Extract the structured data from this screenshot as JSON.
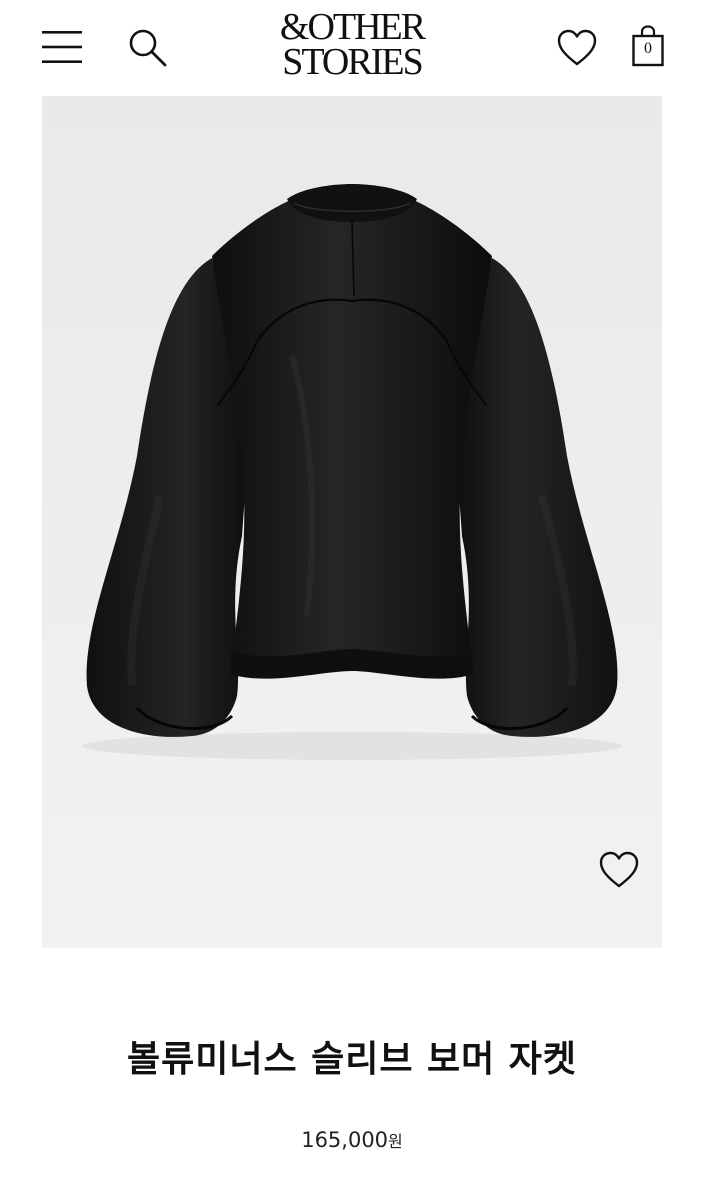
{
  "header": {
    "logo_line1": "&OTHER",
    "logo_line2": "STORIES",
    "cart_count": "0",
    "icons": [
      "menu-icon",
      "search-icon",
      "heart-icon",
      "shopping-bag-icon"
    ]
  },
  "product": {
    "image_icon": "heart-icon",
    "name": "볼류미너스 슬리브 보머 자켓",
    "price": "165,000",
    "currency": "원"
  },
  "colors": {
    "image_background": "#ececee",
    "jacket": "#141414",
    "text": "#111111"
  }
}
